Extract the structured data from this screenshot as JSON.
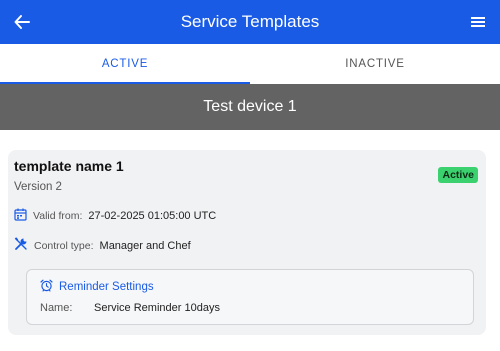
{
  "header": {
    "title": "Service Templates",
    "back_icon": "arrow-left-icon",
    "menu_icon": "hamburger-menu-icon"
  },
  "tabs": [
    {
      "label": "ACTIVE",
      "selected": true
    },
    {
      "label": "INACTIVE",
      "selected": false
    }
  ],
  "device": {
    "name": "Test device 1"
  },
  "template": {
    "name": "template name 1",
    "version": "Version 2",
    "status": "Active",
    "valid_from_label": "Valid from:",
    "valid_from_value": "27-02-2025 01:05:00 UTC",
    "control_type_label": "Control type:",
    "control_type_value": "Manager and Chef",
    "reminder": {
      "title": "Reminder Settings",
      "name_label": "Name:",
      "name_value": "Service Reminder 10days"
    }
  },
  "colors": {
    "primary": "#1a5be6",
    "device_bar": "#636363",
    "active_badge": "#3bd16f",
    "card_bg": "#f1f2f4"
  },
  "icons": {
    "valid_from": "calendar-icon",
    "control_type": "tools-icon",
    "reminder": "alarm-clock-icon"
  }
}
